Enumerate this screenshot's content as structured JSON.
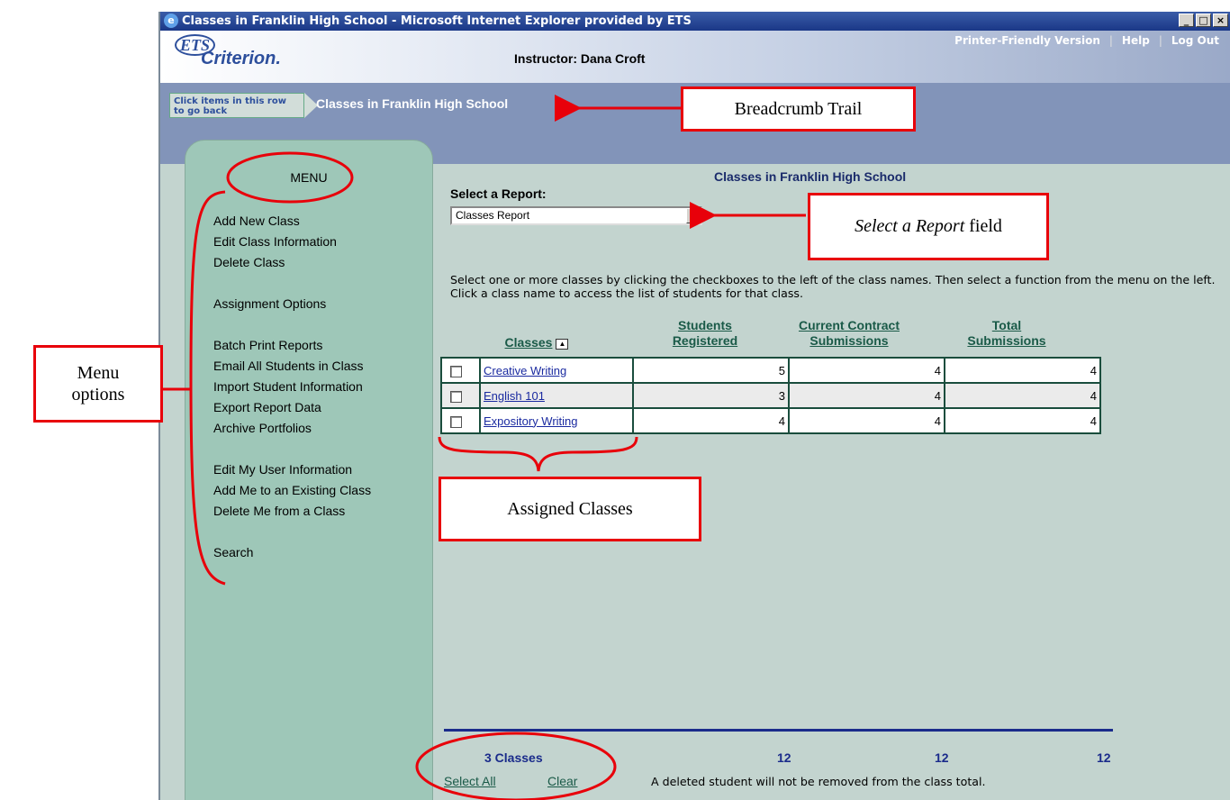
{
  "window": {
    "title": "Classes in Franklin High School - Microsoft Internet Explorer provided by ETS",
    "controls": [
      "_",
      "□",
      "×"
    ]
  },
  "header": {
    "logo_ets": "ETS",
    "logo_name": "Criterion.",
    "instructor": "Instructor: Dana Croft",
    "links": {
      "printer": "Printer-Friendly Version",
      "help": "Help",
      "logout": "Log Out",
      "separator": "|"
    }
  },
  "breadcrumb": {
    "hint": "Click items in this row to go back",
    "current": "Classes in Franklin High School"
  },
  "menu": {
    "title": "MENU",
    "items": [
      "Add New Class",
      "Edit Class Information",
      "Delete Class",
      "Assignment Options",
      "Batch Print Reports",
      "Email All Students in Class",
      "Import Student Information",
      "Export Report Data",
      "Archive Portfolios",
      "Edit My User Information",
      "Add Me to an Existing Class",
      "Delete Me from a Class",
      "Search"
    ]
  },
  "main": {
    "title": "Classes in Franklin High School",
    "report_label": "Select a Report:",
    "report_value": "Classes Report",
    "instructions": "Select one or more classes by clicking the checkboxes to the left of the class names. Then select a function from the menu on the left. Click a class name to access the list of students for that class.",
    "columns": {
      "classes": "Classes",
      "students_1": "Students",
      "students_2": "Registered",
      "contract_1": "Current Contract",
      "contract_2": "Submissions",
      "total_1": "Total",
      "total_2": "Submissions"
    },
    "rows": [
      {
        "name": "Creative Writing",
        "students": "5",
        "contract": "4",
        "total": "4"
      },
      {
        "name": "English 101",
        "students": "3",
        "contract": "4",
        "total": "4"
      },
      {
        "name": "Expository Writing",
        "students": "4",
        "contract": "4",
        "total": "4"
      }
    ],
    "totals": {
      "classes": "3 Classes",
      "students": "12",
      "contract": "12",
      "total": "12"
    },
    "select_all": "Select All",
    "clear": "Clear",
    "note": "A deleted student will not be removed from the class total."
  },
  "annotations": {
    "breadcrumb": "Breadcrumb Trail",
    "select_report_italic": "Select a Report",
    "select_report_rest": " field",
    "menu_options_1": "Menu",
    "menu_options_2": "options",
    "assigned": "Assigned Classes"
  }
}
